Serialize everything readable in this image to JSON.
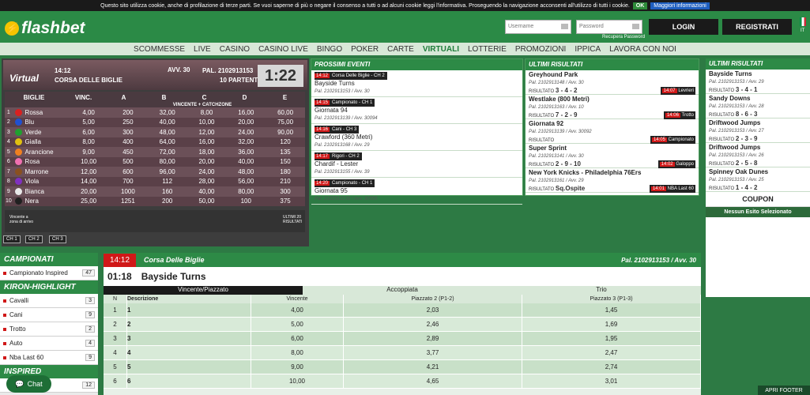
{
  "cookie": {
    "text": "Questo sito utilizza cookie, anche di profilazione di terze parti. Se vuoi saperne di più o negare il consenso a tutti o ad alcuni cookie leggi l'informativa. Proseguendo la navigazione acconsenti all'utilizzo di tutti i cookie.",
    "ok": "OK",
    "more": "Maggiori informazioni"
  },
  "header": {
    "brand": "flashbet",
    "username_ph": "Username",
    "password_ph": "Password",
    "recupera": "Recupera Password",
    "login": "LOGIN",
    "register": "REGISTRATI",
    "lang": "IT"
  },
  "nav": [
    "SCOMMESSE",
    "LIVE",
    "CASINO",
    "CASINO LIVE",
    "BINGO",
    "POKER",
    "CARTE",
    "VIRTUALI",
    "LOTTERIE",
    "PROMOZIONI",
    "IPPICA",
    "LAVORA CON NOI"
  ],
  "nav_active": "VIRTUALI",
  "virtual": {
    "label": "Virtual",
    "time": "14:12",
    "event": "CORSA DELLE BIGLIE",
    "avv": "AVV. 30",
    "pal": "PAL. 2102913153",
    "partenti": "10 PARTENTI",
    "countdown": "1:22",
    "head": [
      "BIGLIE",
      "VINC.",
      "A",
      "B",
      "C",
      "D",
      "E"
    ],
    "sub": "VINCENTE + CATCHZONE",
    "rows": [
      [
        "1",
        "Rossa",
        "#d82020",
        "4,00",
        "200",
        "32,00",
        "8,00",
        "16,00",
        "60,00"
      ],
      [
        "2",
        "Blu",
        "#2050d0",
        "5,00",
        "250",
        "40,00",
        "10,00",
        "20,00",
        "75,00"
      ],
      [
        "3",
        "Verde",
        "#20a030",
        "6,00",
        "300",
        "48,00",
        "12,00",
        "24,00",
        "90,00"
      ],
      [
        "4",
        "Gialla",
        "#e0c010",
        "8,00",
        "400",
        "64,00",
        "16,00",
        "32,00",
        "120"
      ],
      [
        "5",
        "Arancione",
        "#f08020",
        "9,00",
        "450",
        "72,00",
        "18,00",
        "36,00",
        "135"
      ],
      [
        "6",
        "Rosa",
        "#f070b0",
        "10,00",
        "500",
        "80,00",
        "20,00",
        "40,00",
        "150"
      ],
      [
        "7",
        "Marrone",
        "#8a5020",
        "12,00",
        "600",
        "96,00",
        "24,00",
        "48,00",
        "180"
      ],
      [
        "8",
        "Viola",
        "#8030c0",
        "14,00",
        "700",
        "112",
        "28,00",
        "56,00",
        "210"
      ],
      [
        "9",
        "Bianca",
        "#e8e8e8",
        "20,00",
        "1000",
        "160",
        "40,00",
        "80,00",
        "300"
      ],
      [
        "10",
        "Nera",
        "#202020",
        "25,00",
        "1251",
        "200",
        "50,00",
        "100",
        "375"
      ]
    ],
    "footer_left": "Vincente a zona di arrivo",
    "footer_right": "ULTIMI 20 RISULTATI",
    "channels": [
      "CH 1",
      "CH 2",
      "CH 3"
    ]
  },
  "prossimi": {
    "title": "PROSSIMI EVENTI",
    "events": [
      {
        "time": "14:12",
        "tag": "Corsa Delle Biglie - CH 2",
        "name": "Bayside Turns",
        "info": "Pal. 2102913153 / Avv. 30"
      },
      {
        "time": "14:15",
        "tag": "Campionato - CH 1",
        "name": "Giornata 94",
        "info": "Pal. 2102913139 / Avv. 30094"
      },
      {
        "time": "14:16",
        "tag": "Cani - CH 3",
        "name": "Crawford (360 Metri)",
        "info": "Pal. 2102913168 / Avv. 29"
      },
      {
        "time": "14:17",
        "tag": "Rigori - CH 2",
        "name": "Chardif - Lester",
        "info": "Pal. 2102913155 / Avv. 39"
      },
      {
        "time": "14:20",
        "tag": "Campionato - CH 1",
        "name": "Giornata 95",
        "info": "Pal. 2102913139 / Avv. 30095"
      }
    ]
  },
  "ultimi": {
    "title": "ULTIMI RISULTATI",
    "results": [
      {
        "name": "Greyhound Park",
        "info": "Pal. 2102913148 / Avv. 30",
        "label": "RISULTATO",
        "res": "3 - 4 - 2",
        "time": "14:07",
        "tag": "Levrieri"
      },
      {
        "name": "Westlake (800 Metri)",
        "info": "Pal. 2102913163 / Avv. 10",
        "label": "RISULTATO",
        "res": "7 - 2 - 9",
        "time": "14:06",
        "tag": "Trotto"
      },
      {
        "name": "Giornata 92",
        "info": "Pal. 2102913139 / Avv. 30092",
        "label": "RISULTATO",
        "res": "",
        "time": "14:05",
        "tag": "Campionato"
      },
      {
        "name": "Super Sprint",
        "info": "Pal. 2102913141 / Avv. 30",
        "label": "RISULTATO",
        "res": "2 - 9 - 10",
        "time": "14:02",
        "tag": "Galoppo"
      },
      {
        "name": "New York Knicks - Philadelphia 76Ers",
        "info": "Pal. 2102913161 / Avv. 29",
        "label": "RISULTATO",
        "res": "Sq.Ospite",
        "time": "14:01",
        "tag": "NBA Last 60"
      }
    ]
  },
  "right": {
    "title": "ULTIMI RISULTATI",
    "results": [
      {
        "name": "Bayside Turns",
        "info": "Pal. 2102913153 / Avv. 29",
        "label": "RISULTATO",
        "res": "3 - 4 - 1"
      },
      {
        "name": "Sandy Downs",
        "info": "Pal. 2102913153 / Avv. 28",
        "label": "RISULTATO",
        "res": "8 - 6 - 3"
      },
      {
        "name": "Driftwood Jumps",
        "info": "Pal. 2102913153 / Avv. 27",
        "label": "RISULTATO",
        "res": "2 - 3 - 9"
      },
      {
        "name": "Driftwood Jumps",
        "info": "Pal. 2102913153 / Avv. 26",
        "label": "RISULTATO",
        "res": "2 - 5 - 8"
      },
      {
        "name": "Spinney Oak Dunes",
        "info": "Pal. 2102913153 / Avv. 25",
        "label": "RISULTATO",
        "res": "1 - 4 - 2"
      }
    ],
    "coupon": "COUPON",
    "nessun": "Nessun Esito Selezionato"
  },
  "campionati": {
    "title": "CAMPIONATI",
    "items": [
      {
        "label": "Campionato Inspired",
        "count": "47"
      }
    ],
    "kiron": "KIRON-HIGHLIGHT",
    "kitems": [
      {
        "label": "Cavalli",
        "count": "3"
      },
      {
        "label": "Cani",
        "count": "9"
      },
      {
        "label": "Trotto",
        "count": "2"
      },
      {
        "label": "Auto",
        "count": "4"
      },
      {
        "label": "Nba Last 60",
        "count": "9"
      }
    ],
    "inspired": "INSPIRED",
    "icount": "12"
  },
  "main": {
    "time": "14:12",
    "event": "Corsa Delle Biglie",
    "pal": "Pal. 2102913153 / Avv. 30",
    "countdown": "01:18",
    "title": "Bayside Turns",
    "tabs": [
      "Vincente/Piazzato",
      "Accoppiata",
      "Trio"
    ],
    "cols": [
      "N",
      "Descrizione",
      "Vincente",
      "Piazzato 2 (P1-2)",
      "Piazzato 3 (P1-3)"
    ],
    "rows": [
      [
        "1",
        "1",
        "4,00",
        "2,03",
        "1,45"
      ],
      [
        "2",
        "2",
        "5,00",
        "2,46",
        "1,69"
      ],
      [
        "3",
        "3",
        "6,00",
        "2,89",
        "1,95"
      ],
      [
        "4",
        "4",
        "8,00",
        "3,77",
        "2,47"
      ],
      [
        "5",
        "5",
        "9,00",
        "4,21",
        "2,74"
      ],
      [
        "6",
        "6",
        "10,00",
        "4,65",
        "3,01"
      ]
    ]
  },
  "chat": "Chat",
  "apri": "APRI FOOTER"
}
